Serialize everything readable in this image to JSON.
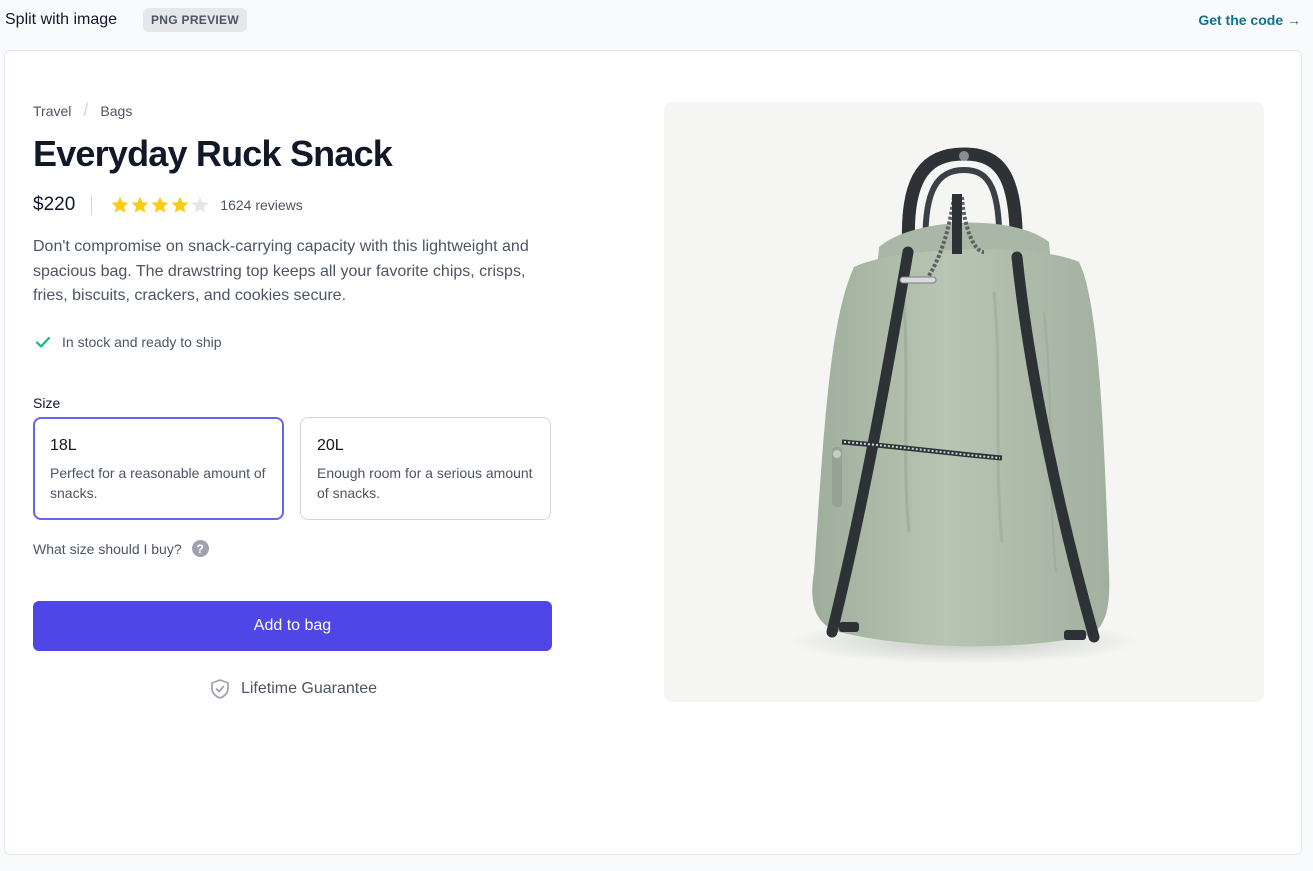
{
  "topbar": {
    "title": "Split with image",
    "badge": "PNG PREVIEW",
    "get_code": "Get the code →"
  },
  "breadcrumb": [
    "Travel",
    "Bags"
  ],
  "product": {
    "name": "Everyday Ruck Snack",
    "price": "$220",
    "rating": 4,
    "rating_max": 5,
    "reviews": "1624 reviews",
    "description": "Don't compromise on snack-carrying capacity with this lightweight and spacious bag. The drawstring top keeps all your favorite chips, crisps, fries, biscuits, crackers, and cookies secure.",
    "stock": "In stock and ready to ship"
  },
  "size": {
    "label": "Size",
    "options": [
      {
        "name": "18L",
        "description": "Perfect for a reasonable amount of snacks.",
        "selected": true
      },
      {
        "name": "20L",
        "description": "Enough room for a serious amount of snacks.",
        "selected": false
      }
    ],
    "help": "What size should I buy?"
  },
  "actions": {
    "add_to_bag": "Add to bag",
    "guarantee": "Lifetime Guarantee"
  },
  "colors": {
    "accent": "#4f46e5",
    "selected_border": "#6366f1",
    "star_filled": "#facc15",
    "star_empty": "#e5e7eb",
    "check": "#10b981"
  }
}
